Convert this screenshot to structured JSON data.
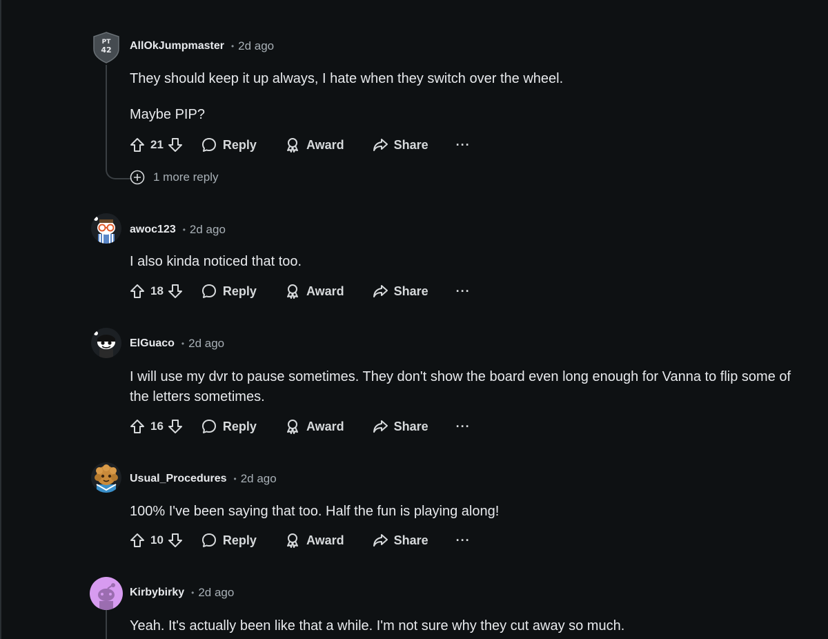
{
  "comments": [
    {
      "username": "AllOkJumpmaster",
      "time": "2d ago",
      "avatar_icon": "shield-badge-icon",
      "avatar_text": "PT 42",
      "paragraphs": [
        "They should keep it up always, I hate when they switch over the wheel.",
        "Maybe PIP?"
      ],
      "votes": "21",
      "more_replies": "1 more reply"
    },
    {
      "username": "awoc123",
      "time": "2d ago",
      "avatar_icon": "snoo-glasses-avatar-icon",
      "paragraphs": [
        "I also kinda noticed that too."
      ],
      "votes": "18"
    },
    {
      "username": "ElGuaco",
      "time": "2d ago",
      "avatar_icon": "snoo-dark-avatar-icon",
      "paragraphs": [
        "I will use my dvr to pause sometimes. They don't show the board even long enough for Vanna to flip some of the letters sometimes."
      ],
      "votes": "16"
    },
    {
      "username": "Usual_Procedures",
      "time": "2d ago",
      "avatar_icon": "snoo-curly-hair-avatar-icon",
      "paragraphs": [
        "100% I've been saying that too. Half the fun is playing along!"
      ],
      "votes": "10"
    },
    {
      "username": "Kirbybirky",
      "time": "2d ago",
      "avatar_icon": "snoo-purple-avatar-icon",
      "paragraphs": [
        "Yeah. It's actually been like that a while. I'm not sure why they cut away so much."
      ]
    }
  ],
  "actions": {
    "reply": "Reply",
    "award": "Award",
    "share": "Share",
    "more": "···"
  },
  "colors": {
    "background": "#0e1113",
    "text": "#e8eaed",
    "muted": "#a8b0b6",
    "thread_line": "#3a3f43",
    "kirby_avatar_bg": "#d79bf0"
  }
}
